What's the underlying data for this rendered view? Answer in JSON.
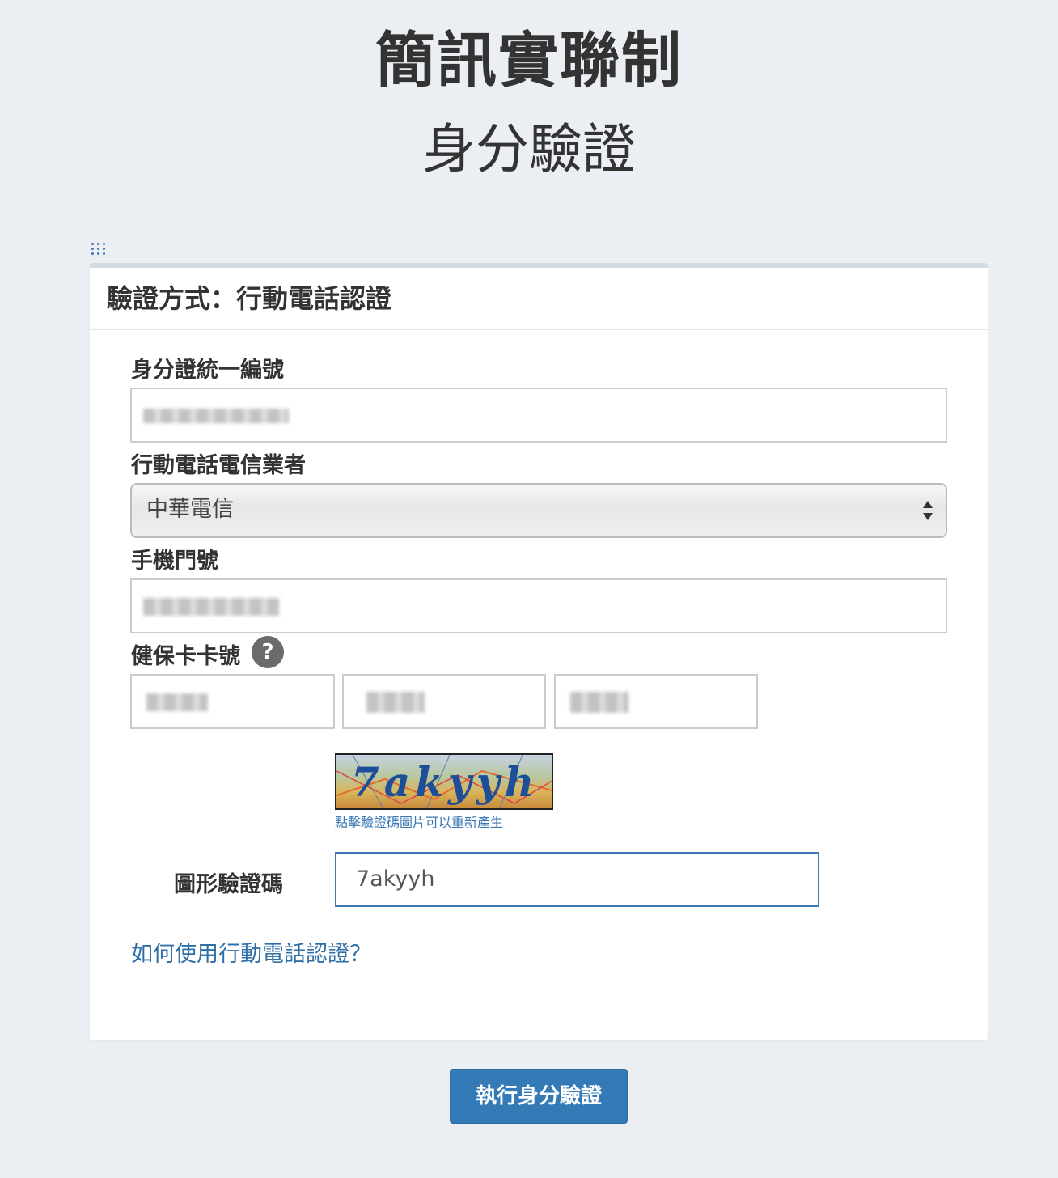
{
  "header": {
    "title": "簡訊實聯制",
    "subtitle": "身分驗證"
  },
  "panel": {
    "heading": "驗證方式：行動電話認證",
    "id_label": "身分證統一編號",
    "carrier_label": "行動電話電信業者",
    "carrier_selected": "中華電信",
    "phone_label": "手機門號",
    "nhi_label": "健保卡卡號",
    "nhi_help": "?",
    "captcha_image_text": "7akyyh",
    "captcha_hint": "點擊驗證碼圖片可以重新產生",
    "captcha_label": "圖形驗證碼",
    "captcha_value": "7akyyh",
    "help_link": "如何使用行動電話認證？"
  },
  "actions": {
    "submit_label": "執行身分驗證"
  },
  "colors": {
    "background": "#ebeef3",
    "primary": "#337ab7",
    "link": "#2f6fa8"
  },
  "icons": [
    "drag-handle-icon",
    "question-icon",
    "select-arrows-icon"
  ]
}
